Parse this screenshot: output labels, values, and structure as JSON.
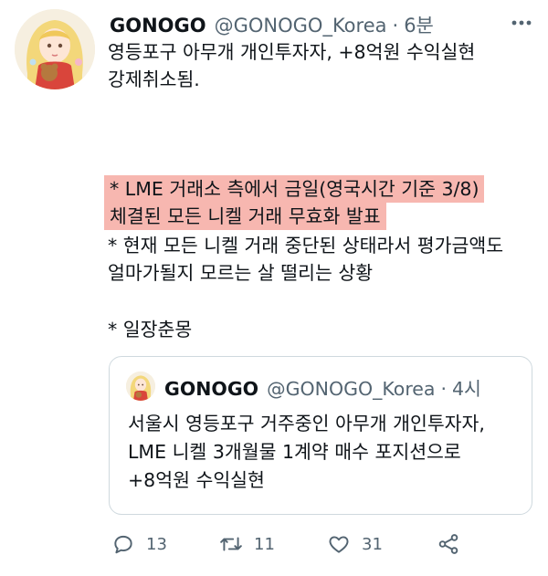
{
  "tweet": {
    "display_name": "GONOGO",
    "handle": "@GONOGO_Korea",
    "separator": "·",
    "time": "6분",
    "lines": {
      "l1": "영등포구 아무개 개인투자자, +8억원 수익실현",
      "l2": "강제취소됨.",
      "hl1": "* LME 거래소 측에서 금일(영국시간 기준 3/8)",
      "hl2": "체결된 모든 니켈 거래 무효화 발표",
      "p3a": "* 현재 모든 니켈 거래 중단된 상태라서 평가금액도",
      "p3b": "얼마가될지 모르는 살 떨리는 상황",
      "p4": "* 일장춘몽"
    },
    "highlight_color": "#f7b7b0"
  },
  "quoted": {
    "display_name": "GONOGO",
    "handle": "@GONOGO_Korea",
    "separator": "·",
    "time": "4시",
    "lines": {
      "q1": "서울시 영등포구 거주중인 아무개 개인투자자,",
      "q2": "LME 니켈 3개월물 1계약 매수 포지션으로",
      "q3": "+8억원 수익실현"
    }
  },
  "actions": {
    "reply_count": "13",
    "retweet_count": "11",
    "like_count": "31"
  },
  "icons": [
    "more-icon",
    "reply-icon",
    "retweet-icon",
    "like-icon",
    "share-icon"
  ]
}
